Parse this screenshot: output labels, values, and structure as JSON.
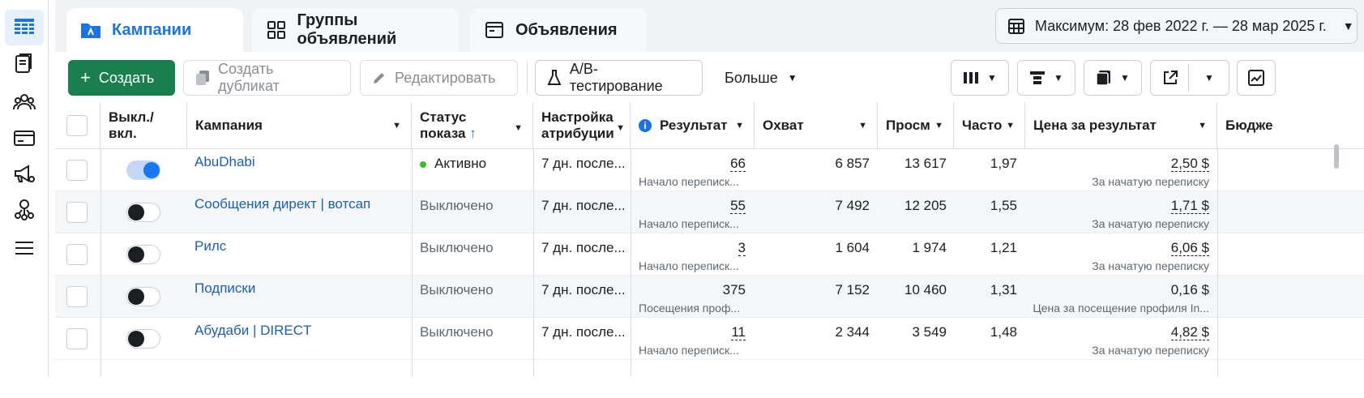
{
  "tabs": [
    {
      "label": "Кампании",
      "icon": "campaign-folder-icon"
    },
    {
      "label": "Группы объявлений",
      "icon": "ad-groups-icon"
    },
    {
      "label": "Объявления",
      "icon": "ads-icon"
    }
  ],
  "date_range": "Максимум: 28 фев 2022 г. — 28 мар 2025 г.",
  "toolbar": {
    "create": "Создать",
    "duplicate": "Создать дубликат",
    "edit": "Редактировать",
    "ab_test": "A/B-тестирование",
    "more": "Больше"
  },
  "columns": {
    "toggle_l1": "Выкл./",
    "toggle_l2": "вкл.",
    "campaign": "Кампания",
    "status_l1": "Статус",
    "status_l2": "показа",
    "status_sort": "↑",
    "attribution_l1": "Настройка",
    "attribution_l2": "атрибуции",
    "result": "Результат",
    "reach": "Охват",
    "impressions": "Просм",
    "frequency": "Часто",
    "cost": "Цена за результат",
    "budget": "Бюдже"
  },
  "rows": [
    {
      "name": "AbuDhabi",
      "on": true,
      "status": "Активно",
      "attribution": "7 дн. после...",
      "result": "66",
      "result_type": "Начало переписк...",
      "reach": "6 857",
      "impressions": "13 617",
      "frequency": "1,97",
      "cost": "2,50 $",
      "cost_type": "За начатую переписку"
    },
    {
      "name": "Сообщения директ | вотсап",
      "on": false,
      "status": "Выключено",
      "attribution": "7 дн. после...",
      "result": "55",
      "result_type": "Начало переписк...",
      "reach": "7 492",
      "impressions": "12 205",
      "frequency": "1,55",
      "cost": "1,71 $",
      "cost_type": "За начатую переписку"
    },
    {
      "name": "Рилс",
      "on": false,
      "status": "Выключено",
      "attribution": "7 дн. после...",
      "result": "3",
      "result_type": "Начало переписк...",
      "reach": "1 604",
      "impressions": "1 974",
      "frequency": "1,21",
      "cost": "6,06 $",
      "cost_type": "За начатую переписку"
    },
    {
      "name": "Подписки",
      "on": false,
      "status": "Выключено",
      "attribution": "7 дн. после...",
      "result": "375",
      "result_type": "Посещения проф...",
      "reach": "7 152",
      "impressions": "10 460",
      "frequency": "1,31",
      "cost": "0,16 $",
      "cost_type": "Цена за посещение профиля In..."
    },
    {
      "name": "Абудаби | DIRECT",
      "on": false,
      "status": "Выключено",
      "attribution": "7 дн. после...",
      "result": "11",
      "result_type": "Начало переписк...",
      "reach": "2 344",
      "impressions": "3 549",
      "frequency": "1,48",
      "cost": "4,82 $",
      "cost_type": "За начатую переписку"
    }
  ],
  "colors": {
    "accent": "#1b74e4",
    "create_green": "#1a7f4e",
    "active_dot": "#42b72a"
  }
}
